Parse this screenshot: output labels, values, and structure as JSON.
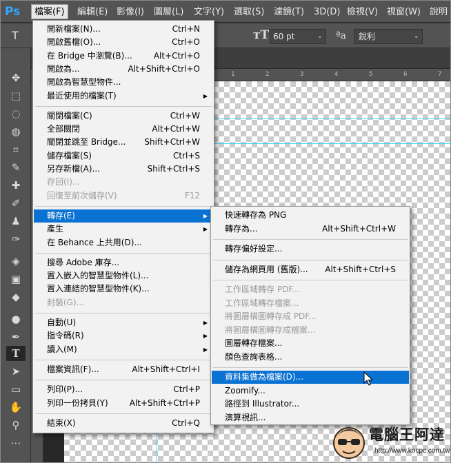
{
  "app": {
    "logo": "Ps",
    "accent_color": "#31a8ff",
    "highlight_color": "#0a72d2"
  },
  "menubar": {
    "items": [
      "檔案(F)",
      "編輯(E)",
      "影像(I)",
      "圖層(L)",
      "文字(Y)",
      "選取(S)",
      "濾鏡(T)",
      "3D(D)",
      "檢視(V)",
      "視窗(W)",
      "說明"
    ],
    "active_index": 0
  },
  "options_bar": {
    "tool_preset_icon": "type-tool-icon",
    "font_size_icon": "font-size-icon",
    "font_size": "60 pt",
    "antialias_icon": "antialias-icon",
    "antialias": "銳利"
  },
  "ruler": {
    "top_ticks": [
      "1",
      "2",
      "3",
      "4",
      "5",
      "6",
      "7",
      "8"
    ]
  },
  "toolbar": {
    "tools": [
      "move-icon",
      "marquee-icon",
      "lasso-icon",
      "quick-select-icon",
      "crop-icon",
      "eyedropper-icon",
      "healing-icon",
      "brush-icon",
      "stamp-icon",
      "history-brush-icon",
      "eraser-icon",
      "gradient-icon",
      "blur-icon",
      "dodge-icon",
      "pen-icon",
      "type-icon",
      "path-select-icon",
      "rectangle-icon",
      "hand-icon",
      "zoom-icon",
      "more-icon"
    ],
    "active_index": 15
  },
  "file_menu": {
    "groups": [
      [
        {
          "label": "開新檔案(N)...",
          "shortcut": "Ctrl+N"
        },
        {
          "label": "開啟舊檔(O)...",
          "shortcut": "Ctrl+O"
        },
        {
          "label": "在 Bridge 中瀏覽(B)...",
          "shortcut": "Alt+Ctrl+O"
        },
        {
          "label": "開啟為...",
          "shortcut": "Alt+Shift+Ctrl+O"
        },
        {
          "label": "開啟為智慧型物件...",
          "shortcut": ""
        },
        {
          "label": "最近使用的檔案(T)",
          "shortcut": "",
          "submenu": true
        }
      ],
      [
        {
          "label": "關閉檔案(C)",
          "shortcut": "Ctrl+W"
        },
        {
          "label": "全部關閉",
          "shortcut": "Alt+Ctrl+W"
        },
        {
          "label": "關閉並跳至 Bridge...",
          "shortcut": "Shift+Ctrl+W"
        },
        {
          "label": "儲存檔案(S)",
          "shortcut": "Ctrl+S"
        },
        {
          "label": "另存新檔(A)...",
          "shortcut": "Shift+Ctrl+S"
        },
        {
          "label": "存回(I)...",
          "shortcut": "",
          "disabled": true
        },
        {
          "label": "回復至前次儲存(V)",
          "shortcut": "F12",
          "disabled": true
        }
      ],
      [
        {
          "label": "轉存(E)",
          "shortcut": "",
          "submenu": true,
          "highlighted": true
        },
        {
          "label": "產生",
          "shortcut": "",
          "submenu": true
        },
        {
          "label": "在 Behance 上共用(D)...",
          "shortcut": ""
        }
      ],
      [
        {
          "label": "搜尋 Adobe 庫存...",
          "shortcut": ""
        },
        {
          "label": "置入嵌入的智慧型物件(L)...",
          "shortcut": ""
        },
        {
          "label": "置入連結的智慧型物件(K)...",
          "shortcut": ""
        },
        {
          "label": "封裝(G)...",
          "shortcut": "",
          "disabled": true
        }
      ],
      [
        {
          "label": "自動(U)",
          "shortcut": "",
          "submenu": true
        },
        {
          "label": "指令碼(R)",
          "shortcut": "",
          "submenu": true
        },
        {
          "label": "讀入(M)",
          "shortcut": "",
          "submenu": true
        }
      ],
      [
        {
          "label": "檔案資訊(F)...",
          "shortcut": "Alt+Shift+Ctrl+I"
        }
      ],
      [
        {
          "label": "列印(P)...",
          "shortcut": "Ctrl+P"
        },
        {
          "label": "列印一份拷貝(Y)",
          "shortcut": "Alt+Shift+Ctrl+P"
        }
      ],
      [
        {
          "label": "結束(X)",
          "shortcut": "Ctrl+Q"
        }
      ]
    ]
  },
  "export_menu": {
    "groups": [
      [
        {
          "label": "快速轉存為 PNG",
          "shortcut": ""
        },
        {
          "label": "轉存為...",
          "shortcut": "Alt+Shift+Ctrl+W"
        }
      ],
      [
        {
          "label": "轉存偏好設定...",
          "shortcut": ""
        }
      ],
      [
        {
          "label": "儲存為網頁用 (舊版)...",
          "shortcut": "Alt+Shift+Ctrl+S"
        }
      ],
      [
        {
          "label": "工作區域轉存 PDF...",
          "shortcut": "",
          "disabled": true
        },
        {
          "label": "工作區域轉存檔案...",
          "shortcut": "",
          "disabled": true
        },
        {
          "label": "將圖層構圖轉存成 PDF...",
          "shortcut": "",
          "disabled": true
        },
        {
          "label": "將圖層構圖轉存成檔案...",
          "shortcut": "",
          "disabled": true
        },
        {
          "label": "圖層轉存檔案...",
          "shortcut": ""
        },
        {
          "label": "顏色查詢表格...",
          "shortcut": ""
        }
      ],
      [
        {
          "label": "資料集做為檔案(D)...",
          "shortcut": "",
          "highlighted": true
        },
        {
          "label": "Zoomify...",
          "shortcut": ""
        },
        {
          "label": "路徑到 Illustrator...",
          "shortcut": ""
        },
        {
          "label": "演算視訊...",
          "shortcut": ""
        }
      ]
    ]
  },
  "watermark": {
    "title": "電腦王阿達",
    "url": "http://www.kocpc.com.tw"
  }
}
